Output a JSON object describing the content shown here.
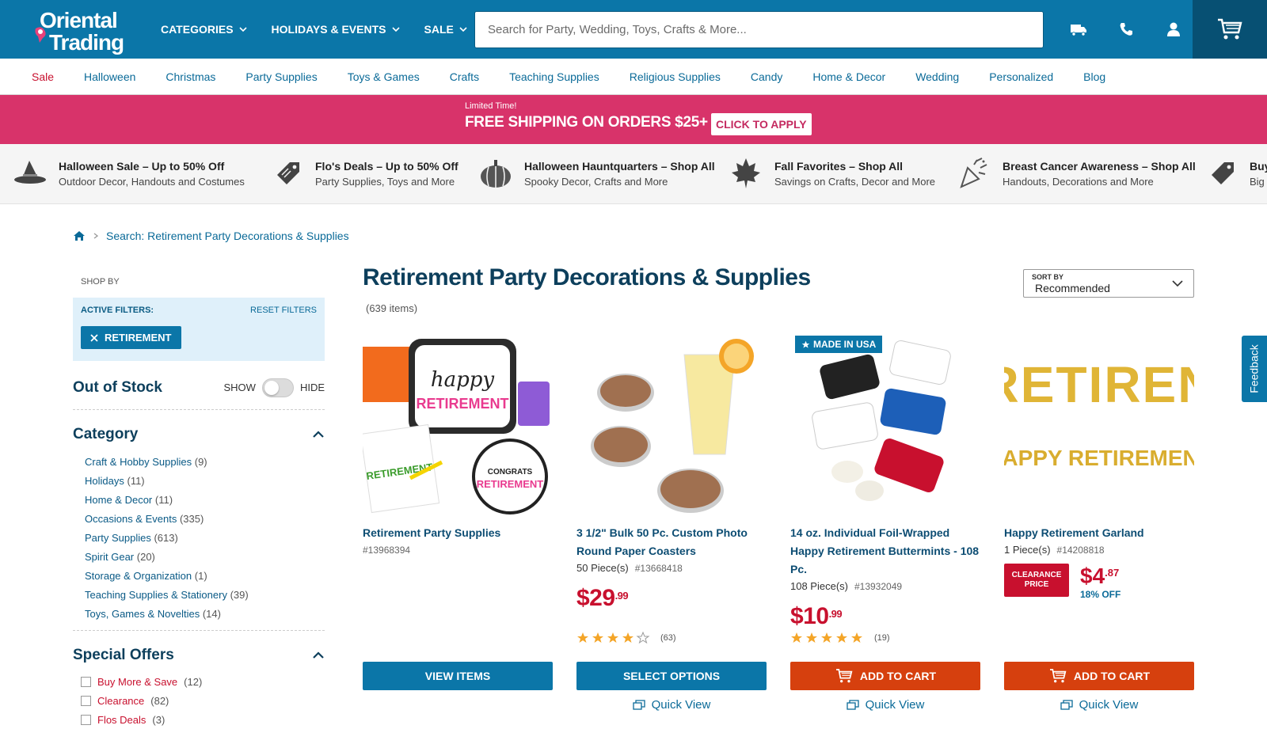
{
  "header": {
    "logo_line1": "Oriental",
    "logo_line2": "Trading",
    "nav": [
      {
        "label": "CATEGORIES"
      },
      {
        "label": "HOLIDAYS & EVENTS"
      },
      {
        "label": "SALE"
      }
    ],
    "search_placeholder": "Search for Party, Wedding, Toys, Crafts & More..."
  },
  "categories": [
    "Sale",
    "Halloween",
    "Christmas",
    "Party Supplies",
    "Toys & Games",
    "Crafts",
    "Teaching Supplies",
    "Religious Supplies",
    "Candy",
    "Home & Decor",
    "Wedding",
    "Personalized",
    "Blog"
  ],
  "promo": {
    "small": "Limited Time!",
    "big": "FREE SHIPPING ON ORDERS $25+",
    "cta": "CLICK TO APPLY"
  },
  "deals": [
    {
      "title": "Halloween Sale – Up to 50% Off",
      "sub": "Outdoor Decor, Handouts and Costumes",
      "icon": "witch-hat-icon"
    },
    {
      "title": "Flo's Deals – Up to 50% Off",
      "sub": "Party Supplies, Toys and More",
      "icon": "price-tag-icon"
    },
    {
      "title": "Halloween Hauntquarters – Shop All",
      "sub": "Spooky Decor, Crafts and More",
      "icon": "pumpkin-icon"
    },
    {
      "title": "Fall Favorites – Shop All",
      "sub": "Savings on Crafts, Decor and More",
      "icon": "maple-leaf-icon"
    },
    {
      "title": "Breast Cancer Awareness – Shop All",
      "sub": "Handouts, Decorations and More",
      "icon": "party-popper-icon"
    },
    {
      "title": "Buy",
      "sub": "Big",
      "icon": "price-tag-icon"
    }
  ],
  "breadcrumb": {
    "current": "Search: Retirement Party Decorations & Supplies"
  },
  "sidebar": {
    "shop_by": "SHOP BY",
    "active_filters": "ACTIVE FILTERS:",
    "reset": "RESET FILTERS",
    "chip": "RETIREMENT",
    "oos_title": "Out of Stock",
    "show": "SHOW",
    "hide": "HIDE",
    "category_title": "Category",
    "categories": [
      {
        "name": "Craft & Hobby Supplies",
        "count": "(9)"
      },
      {
        "name": "Holidays",
        "count": "(11)"
      },
      {
        "name": "Home & Decor",
        "count": "(11)"
      },
      {
        "name": "Occasions & Events",
        "count": "(335)"
      },
      {
        "name": "Party Supplies",
        "count": "(613)"
      },
      {
        "name": "Spirit Gear",
        "count": "(20)"
      },
      {
        "name": "Storage & Organization",
        "count": "(1)"
      },
      {
        "name": "Teaching Supplies & Stationery",
        "count": "(39)"
      },
      {
        "name": "Toys, Games & Novelties",
        "count": "(14)"
      }
    ],
    "offers_title": "Special Offers",
    "offers": [
      {
        "name": "Buy More & Save",
        "count": "(12)"
      },
      {
        "name": "Clearance",
        "count": "(82)"
      },
      {
        "name": "Flos Deals",
        "count": "(3)"
      }
    ]
  },
  "main": {
    "title": "Retirement Party Decorations & Supplies",
    "count": "(639 items)",
    "sort_label": "SORT BY",
    "sort_value": "Recommended",
    "quick_view": "Quick View"
  },
  "products": [
    {
      "name": "Retirement Party Supplies",
      "pieces": "",
      "sku": "#13968394",
      "price_dollars": "",
      "price_cents": "",
      "rating": 0,
      "reviews": "",
      "button": "VIEW ITEMS",
      "button_color": "blue"
    },
    {
      "name": "3 1/2\" Bulk 50 Pc. Custom Photo Round Paper Coasters",
      "pieces": "50 Piece(s)",
      "sku": "#13668418",
      "price_dollars": "$29",
      "price_cents": ".99",
      "rating": 3.5,
      "reviews": "(63)",
      "button": "SELECT OPTIONS",
      "button_color": "blue"
    },
    {
      "name": "14 oz. Individual Foil-Wrapped Happy Retirement Buttermints - 108 Pc.",
      "pieces": "108 Piece(s)",
      "sku": "#13932049",
      "price_dollars": "$10",
      "price_cents": ".99",
      "rating": 5,
      "reviews": "(19)",
      "button": "ADD TO CART",
      "button_color": "red",
      "badge": "MADE IN USA"
    },
    {
      "name": "Happy Retirement Garland",
      "pieces": "1 Piece(s)",
      "sku": "#14208818",
      "clearance_label": "CLEARANCE PRICE",
      "price_dollars": "$4",
      "price_cents": ".87",
      "discount": "18% OFF",
      "button": "ADD TO CART",
      "button_color": "red"
    }
  ],
  "feedback": "Feedback",
  "colors": {
    "brand_blue": "#0b76a8",
    "promo_pink": "#d8336a",
    "sale_red": "#c8102e",
    "cart_orange": "#d6400e"
  }
}
